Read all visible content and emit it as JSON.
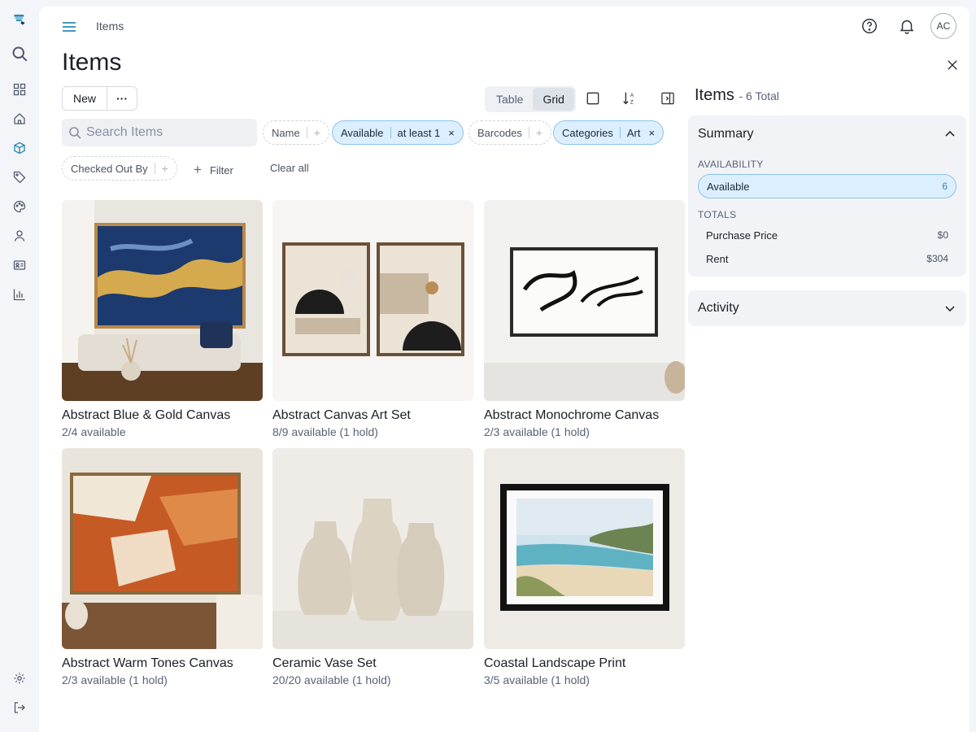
{
  "app": {
    "logo": "brand-logo"
  },
  "rail": {
    "items": [
      {
        "icon": "search-icon"
      },
      {
        "icon": "dashboard-icon"
      },
      {
        "icon": "home-icon"
      },
      {
        "icon": "box-icon",
        "active": true
      },
      {
        "icon": "tag-icon"
      },
      {
        "icon": "palette-icon"
      },
      {
        "icon": "user-icon"
      },
      {
        "icon": "id-card-icon"
      },
      {
        "icon": "bar-chart-icon"
      }
    ],
    "bottom": [
      {
        "icon": "gear-icon"
      },
      {
        "icon": "logout-icon"
      }
    ]
  },
  "header": {
    "breadcrumb": "Items",
    "avatar": "AC"
  },
  "page": {
    "title": "Items"
  },
  "toolbar": {
    "new_label": "New",
    "more_label": "···",
    "view_table": "Table",
    "view_grid": "Grid",
    "active_view": "Grid"
  },
  "search": {
    "placeholder": "Search Items"
  },
  "filters": {
    "name": "Name",
    "available": {
      "label": "Available",
      "value": "at least 1"
    },
    "barcodes": "Barcodes",
    "categories": {
      "label": "Categories",
      "value": "Art"
    },
    "checked_out_by": "Checked Out By",
    "add_filter": "Filter",
    "clear_all": "Clear all",
    "plus": "+",
    "remove": "×"
  },
  "items": [
    {
      "name": "Abstract Blue & Gold Canvas",
      "availability": "2/4 available"
    },
    {
      "name": "Abstract Canvas Art Set",
      "availability": "8/9 available (1 hold)"
    },
    {
      "name": "Abstract Monochrome Canvas",
      "availability": "2/3 available (1 hold)"
    },
    {
      "name": "Abstract Warm Tones Canvas",
      "availability": "2/3 available (1 hold)"
    },
    {
      "name": "Ceramic Vase Set",
      "availability": "20/20 available (1 hold)"
    },
    {
      "name": "Coastal Landscape Print",
      "availability": "3/5 available (1 hold)"
    }
  ],
  "side": {
    "title": "Items",
    "total": "- 6 Total",
    "summary": {
      "heading": "Summary",
      "availability_label": "AVAILABILITY",
      "available": {
        "label": "Available",
        "count": "6"
      },
      "totals_label": "TOTALS",
      "purchase_price": {
        "label": "Purchase Price",
        "value": "$0"
      },
      "rent": {
        "label": "Rent",
        "value": "$304"
      }
    },
    "activity": {
      "heading": "Activity"
    }
  },
  "colors": {
    "accent": "#2a8ab5",
    "chip_selected": "#dcefff",
    "chip_border": "#8cc4e8"
  }
}
